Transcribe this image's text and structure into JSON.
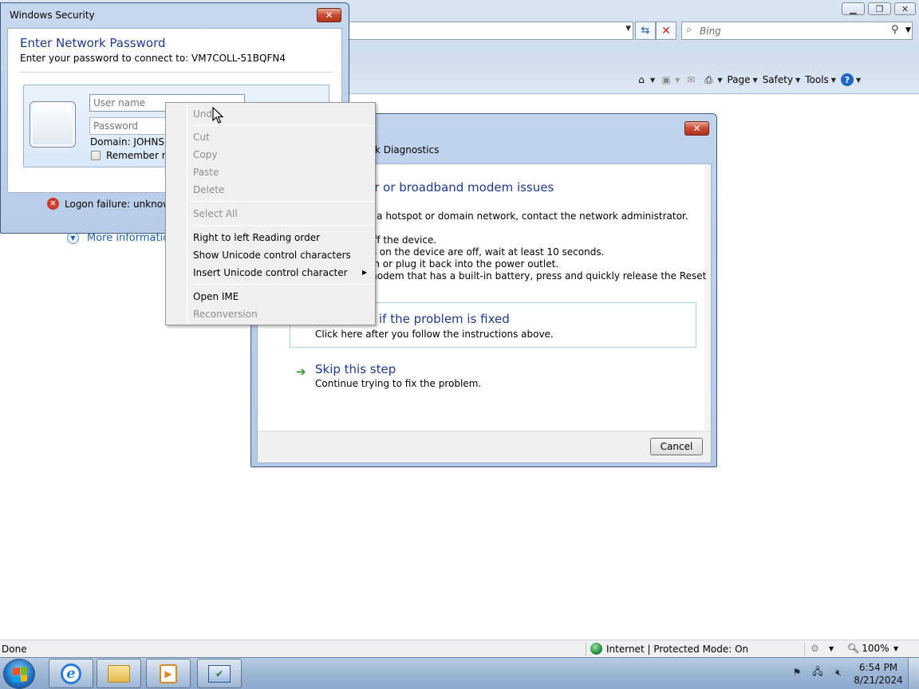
{
  "browser": {
    "window_buttons": {
      "minimize": "▭",
      "restore": "⧉",
      "close": "✕"
    },
    "search": {
      "placeholder": "Bing"
    },
    "command_bar": {
      "page": "Page",
      "safety": "Safety",
      "tools": "Tools"
    },
    "more_info": "More information",
    "status": {
      "text": "Done",
      "zone": "Internet | Protected Mode: On",
      "zoom": "100%"
    }
  },
  "diagnostics": {
    "title": "rk Diagnostics",
    "heading": "er or broadband modem issues",
    "lines": [
      "o a hotspot or domain network, contact the network administrator.",
      "off the device.",
      "ts on the device are off, wait at least 10 seconds.",
      "on or plug it back into the power outlet.",
      "modem that has a built-in battery, press and quickly release the Reset"
    ],
    "check": {
      "title": "e if the problem is fixed",
      "subtitle": "Click here after you follow the instructions above."
    },
    "skip": {
      "title": "Skip this step",
      "subtitle": "Continue trying to fix the problem."
    },
    "cancel": "Cancel"
  },
  "security": {
    "title": "Windows Security",
    "heading": "Enter Network Password",
    "subheading": "Enter your password to connect to: VM7COLL-51BQFN4",
    "username_placeholder": "User name",
    "password_placeholder": "Password",
    "domain": "Domain: JOHNSM",
    "remember": "Remember my",
    "error": "Logon failure: unknown"
  },
  "context_menu": {
    "items": [
      {
        "label": "Undo",
        "enabled": false
      },
      {
        "label": "Cut",
        "enabled": false
      },
      {
        "label": "Copy",
        "enabled": false
      },
      {
        "label": "Paste",
        "enabled": false
      },
      {
        "label": "Delete",
        "enabled": false
      },
      {
        "label": "Select All",
        "enabled": false
      },
      {
        "label": "Right to left Reading order",
        "enabled": true
      },
      {
        "label": "Show Unicode control characters",
        "enabled": true
      },
      {
        "label": "Insert Unicode control character",
        "enabled": true,
        "submenu": true
      },
      {
        "label": "Open IME",
        "enabled": true
      },
      {
        "label": "Reconversion",
        "enabled": false
      }
    ]
  },
  "taskbar": {
    "clock_time": "6:54 PM",
    "clock_date": "8/21/2024"
  }
}
